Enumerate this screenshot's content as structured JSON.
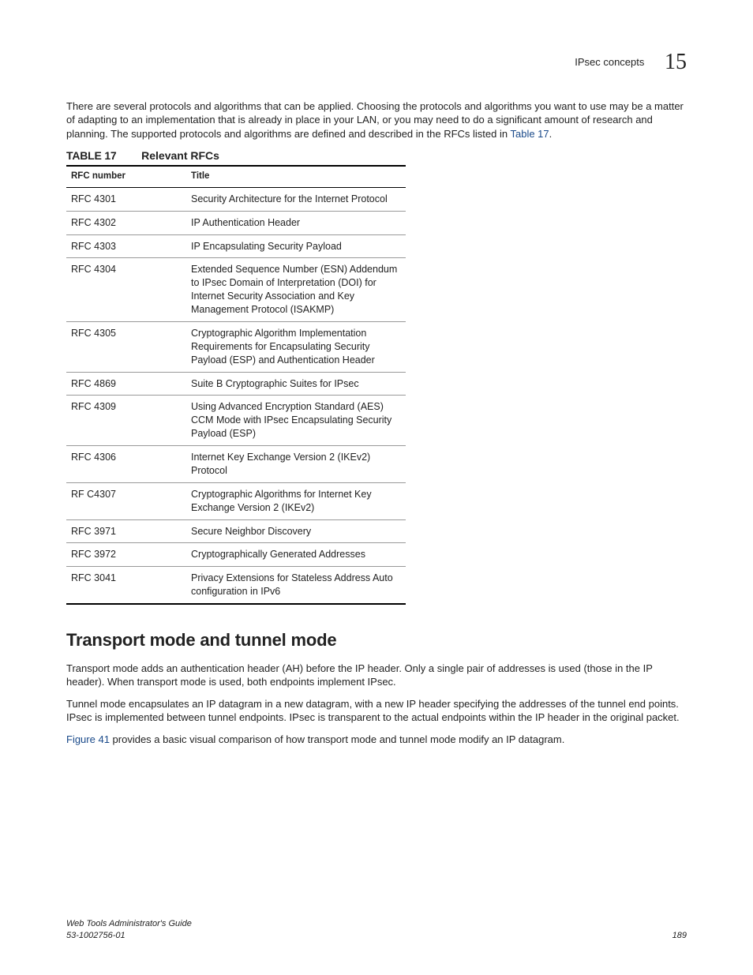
{
  "header": {
    "section_title": "IPsec concepts",
    "chapter_number": "15"
  },
  "intro_paragraph": "There are several protocols and algorithms that can be applied. Choosing the protocols and algorithms you want to use may be a matter of adapting to an implementation that is already in place in your LAN, or you may need to do a significant amount of research and planning. The supported protocols and algorithms are defined and described in the RFCs listed in ",
  "intro_link": "Table 17",
  "intro_tail": ".",
  "table": {
    "label": "TABLE 17",
    "title": "Relevant RFCs",
    "col1": "RFC number",
    "col2": "Title",
    "rows": [
      {
        "num": "RFC 4301",
        "title": "Security Architecture for the Internet Protocol"
      },
      {
        "num": "RFC 4302",
        "title": "IP Authentication Header"
      },
      {
        "num": "RFC 4303",
        "title": "IP Encapsulating Security Payload"
      },
      {
        "num": "RFC 4304",
        "title": "Extended Sequence Number (ESN) Addendum to IPsec Domain of Interpretation (DOI) for Internet Security Association and Key Management Protocol (ISAKMP)"
      },
      {
        "num": "RFC 4305",
        "title": "Cryptographic Algorithm Implementation Requirements for Encapsulating Security Payload (ESP) and Authentication Header"
      },
      {
        "num": "RFC 4869",
        "title": "Suite B Cryptographic Suites for IPsec"
      },
      {
        "num": "RFC 4309",
        "title": "Using Advanced Encryption Standard (AES) CCM Mode with IPsec Encapsulating Security Payload (ESP)"
      },
      {
        "num": "RFC 4306",
        "title": "Internet Key Exchange Version 2 (IKEv2) Protocol"
      },
      {
        "num": "RF C4307",
        "title": "Cryptographic Algorithms for Internet Key Exchange Version 2 (IKEv2)"
      },
      {
        "num": "RFC 3971",
        "title": "Secure Neighbor Discovery"
      },
      {
        "num": "RFC 3972",
        "title": "Cryptographically Generated Addresses"
      },
      {
        "num": "RFC 3041",
        "title": "Privacy Extensions for Stateless Address Auto configuration in IPv6"
      }
    ]
  },
  "section2": {
    "heading": "Transport mode and tunnel mode",
    "p1": "Transport mode adds an authentication header (AH) before the IP header. Only a single pair of addresses is used (those in the IP header). When transport mode is used, both endpoints implement IPsec.",
    "p2": "Tunnel mode encapsulates an IP datagram in a new datagram, with a new IP header specifying the addresses of the tunnel end points. IPsec is implemented between tunnel endpoints. IPsec is transparent to the actual endpoints within the IP header in the original packet.",
    "p3_link": "Figure 41",
    "p3_tail": " provides a basic visual comparison of how transport mode and tunnel mode modify an IP datagram."
  },
  "footer": {
    "doc_title": "Web Tools Administrator's Guide",
    "doc_id": "53-1002756-01",
    "page_number": "189"
  }
}
